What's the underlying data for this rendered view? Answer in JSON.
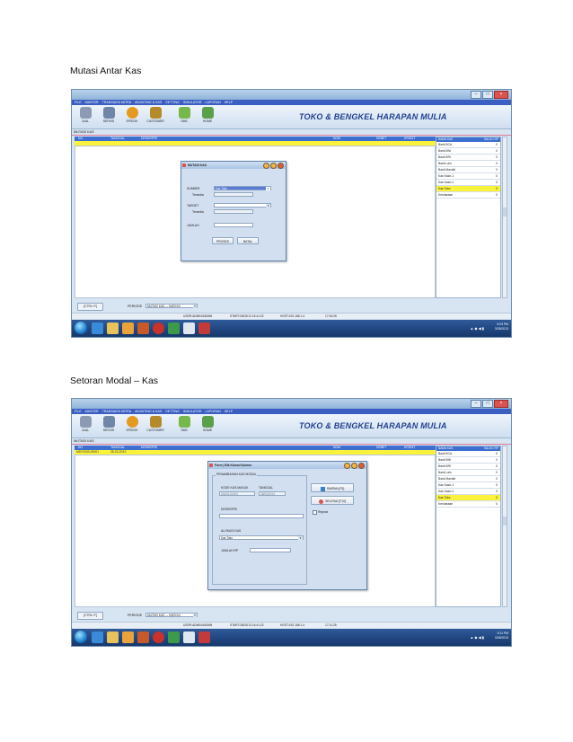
{
  "captions": {
    "first": "Mutasi Antar Kas",
    "second": "Setoran Modal – Kas"
  },
  "app": {
    "menu": [
      "FILE",
      "MASTER",
      "TRANSAKSI MITRA",
      "AKUNTING & KAS",
      "SETTING",
      "SIMULATOR",
      "LAPORAN",
      "HELP"
    ],
    "toolbar": [
      "JUAL",
      "SERVIS",
      "EPIDOK",
      "CUSTOMER",
      "SMS",
      "HOME"
    ],
    "brand": "TOKO & BENGKEL HARAPAN MULIA",
    "doc_title": "MUTASI KAS",
    "grid_headers": [
      "NO.",
      "TANGGAL",
      "DESKRIPSI",
      "NOM",
      "DEBET",
      "KREDIT"
    ],
    "right_headers": [
      "NAMA KAS",
      "SALDO RP"
    ],
    "kas_list": [
      {
        "name": "Bank BCA",
        "saldo": "0"
      },
      {
        "name": "Bank BNI",
        "saldo": "0"
      },
      {
        "name": "Bank BRI",
        "saldo": "0"
      },
      {
        "name": "Bank Lain",
        "saldo": "0"
      },
      {
        "name": "Bank Mandiri",
        "saldo": "0"
      },
      {
        "name": "Kas Kasir-1",
        "saldo": "0"
      },
      {
        "name": "Kas Kasir-2",
        "saldo": "0"
      },
      {
        "name": "Kas Toko",
        "saldo": "0"
      },
      {
        "name": "Kendaraan",
        "saldo": "0"
      }
    ],
    "selected_kas": "Kas Toko",
    "ctrl_btn": "[CTRL+F]",
    "periode_label": "PERIODE",
    "periode_value": "MUTASI KAS --- HARI INI",
    "status": {
      "user": "USER:ADMIN/ADMIN",
      "start": "START:28/03/13 16:41:22",
      "host": "HOST:192.168.1.4",
      "time1": "17:04:26",
      "time2": "17:11:28"
    },
    "clock1": [
      "5:03 PM",
      "3/28/2013"
    ],
    "clock2": [
      "5:11 PM",
      "3/28/2013"
    ]
  },
  "dialog1": {
    "title": "MUTASI KAS",
    "sumber_label": "SUMBER",
    "sumber_value": "Kas Toko",
    "tersedia_label": "Tersedia",
    "target_label": "TARGET",
    "jumlah_label": "JUMLAH",
    "proses_btn": "PROSES",
    "batal_btn": "BATAL"
  },
  "screen2": {
    "row_no": "MDYS/03-00001",
    "row_date": "28-03-2013"
  },
  "dialog2": {
    "title": "Form | Blk Kisami Kumon",
    "group_label": "PENAMBAHAN KAS MODAL",
    "kode_label": "KODE KAS MASUK",
    "kode_value": "KM/03-00001",
    "tanggal_label": "TANGGAL",
    "tanggal_value": "28/03/2013",
    "deskripsi_label": "DESKRIPSI",
    "alokasi_label": "ALOKASI KAS",
    "alokasi_value": "Kas Toko",
    "jumlah_label": "JUMLAH RP",
    "simpan_btn": "SIMPAN [F5]",
    "selesai_btn": "SELESAI [F10]",
    "repeat_label": "Repeat"
  }
}
